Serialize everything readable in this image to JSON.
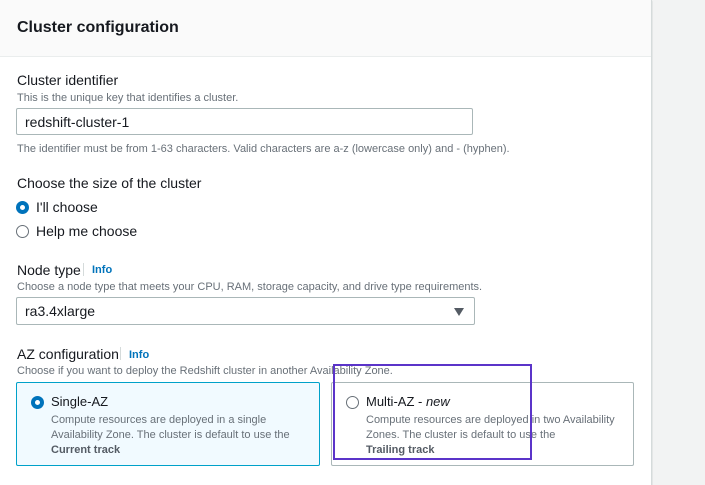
{
  "panel": {
    "title": "Cluster configuration"
  },
  "identifier": {
    "label": "Cluster identifier",
    "description": "This is the unique key that identifies a cluster.",
    "value": "redshift-cluster-1",
    "constraint": "The identifier must be from 1-63 characters. Valid characters are a-z (lowercase only) and - (hyphen)."
  },
  "size": {
    "label": "Choose the size of the cluster",
    "options": [
      {
        "label": "I'll choose",
        "checked": true
      },
      {
        "label": "Help me choose",
        "checked": false
      }
    ]
  },
  "node_type": {
    "label": "Node type",
    "info": "Info",
    "description": "Choose a node type that meets your CPU, RAM, storage capacity, and drive type requirements.",
    "selected": "ra3.4xlarge",
    "icon": "caret-down-icon"
  },
  "az": {
    "label": "AZ configuration",
    "info": "Info",
    "description": "Choose if you want to deploy the Redshift cluster in another Availability Zone.",
    "options": [
      {
        "title": "Single-AZ",
        "title_suffix": "",
        "desc": "Compute resources are deployed in a single Availability Zone. The cluster is default to use the",
        "track": "Current track",
        "checked": true
      },
      {
        "title": "Multi-AZ - ",
        "title_suffix": "new",
        "desc": "Compute resources are deployed in two Availability Zones. The cluster is default to use the",
        "track": "Trailing track",
        "checked": false
      }
    ]
  },
  "colors": {
    "accent": "#0073bb",
    "highlight": "#5b34c9",
    "selected_tile_bg": "#f1faff"
  }
}
